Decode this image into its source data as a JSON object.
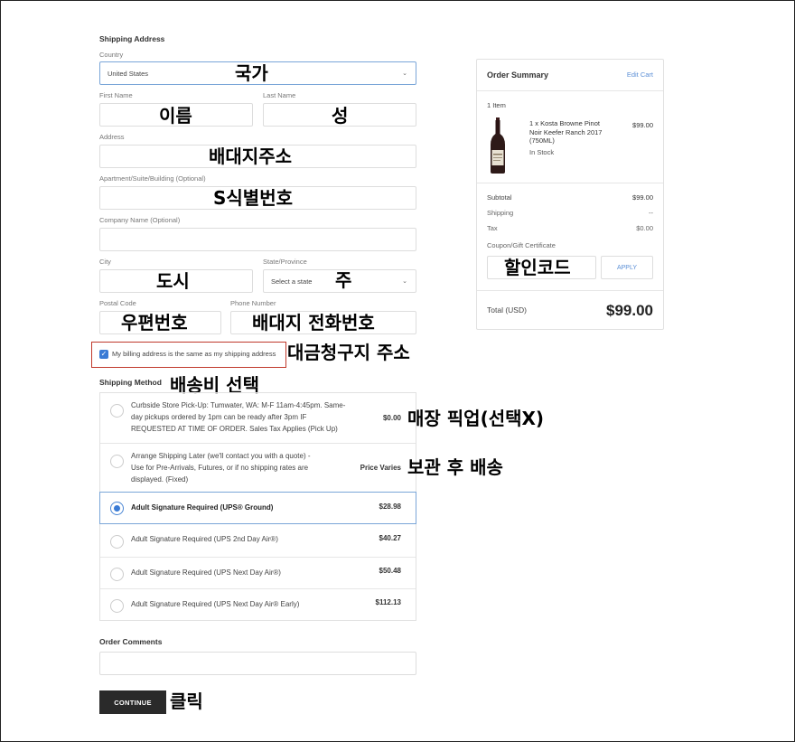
{
  "shipping_address": {
    "title": "Shipping Address",
    "country_label": "Country",
    "country_value": "United States",
    "first_name_label": "First Name",
    "last_name_label": "Last Name",
    "address_label": "Address",
    "apartment_label": "Apartment/Suite/Building (Optional)",
    "company_label": "Company Name (Optional)",
    "city_label": "City",
    "state_label": "State/Province",
    "state_placeholder": "Select a state",
    "postal_label": "Postal Code",
    "phone_label": "Phone Number",
    "billing_same_label": "My billing address is the same as my shipping address",
    "billing_same_checked": true
  },
  "shipping_method": {
    "title": "Shipping Method",
    "options": [
      {
        "lines": [
          "Curbside Store Pick-Up: Tumwater, WA: M-F 11am-4:45pm. Same-",
          "day pickups ordered by 1pm can be ready after 3pm IF",
          "REQUESTED AT TIME OF ORDER. Sales Tax Applies (Pick Up)"
        ],
        "price": "$0.00",
        "selected": false
      },
      {
        "lines": [
          "Arrange Shipping Later (we'll contact you with a quote) -",
          "Use for Pre-Arrivals, Futures, or if no shipping rates are",
          "displayed. (Fixed)"
        ],
        "price": "Price Varies",
        "selected": false
      },
      {
        "lines": [
          "Adult Signature Required (UPS® Ground)"
        ],
        "price": "$28.98",
        "selected": true
      },
      {
        "lines": [
          "Adult Signature Required (UPS 2nd Day Air®)"
        ],
        "price": "$40.27",
        "selected": false
      },
      {
        "lines": [
          "Adult Signature Required (UPS Next Day Air®)"
        ],
        "price": "$50.48",
        "selected": false
      },
      {
        "lines": [
          "Adult Signature Required (UPS Next Day Air® Early)"
        ],
        "price": "$112.13",
        "selected": false
      }
    ]
  },
  "order_comments": {
    "title": "Order Comments"
  },
  "continue_button": "CONTINUE",
  "order_summary": {
    "title": "Order Summary",
    "edit_cart": "Edit Cart",
    "item_count": "1 Item",
    "item_name_lines": [
      "1 x Kosta Browne Pinot",
      "Noir Keefer Ranch 2017",
      "(750ML)"
    ],
    "item_stock": "In Stock",
    "item_price": "$99.00",
    "subtotal_label": "Subtotal",
    "subtotal_value": "$99.00",
    "shipping_label": "Shipping",
    "shipping_value": "--",
    "tax_label": "Tax",
    "tax_value": "$0.00",
    "coupon_label": "Coupon/Gift Certificate",
    "apply_label": "APPLY",
    "total_label": "Total (USD)",
    "total_value": "$99.00"
  },
  "annotations": {
    "country": "국가",
    "first_name": "이름",
    "last_name": "성",
    "address": "배대지주소",
    "apartment": "S식별번호",
    "city": "도시",
    "state": "주",
    "postal": "우편번호",
    "phone": "배대지 전화번호",
    "billing": "대금청구지 주소",
    "shipping_method": "배송비 선택",
    "pickup": "매장 픽업(선택X)",
    "ship_later": "보관 후 배송",
    "coupon": "할인코드",
    "continue": "클릭"
  },
  "colors": {
    "accent": "#3a7bd5",
    "highlight_box": "#c0392b",
    "button_bg": "#2a2a2a",
    "link": "#5b8fd6"
  }
}
